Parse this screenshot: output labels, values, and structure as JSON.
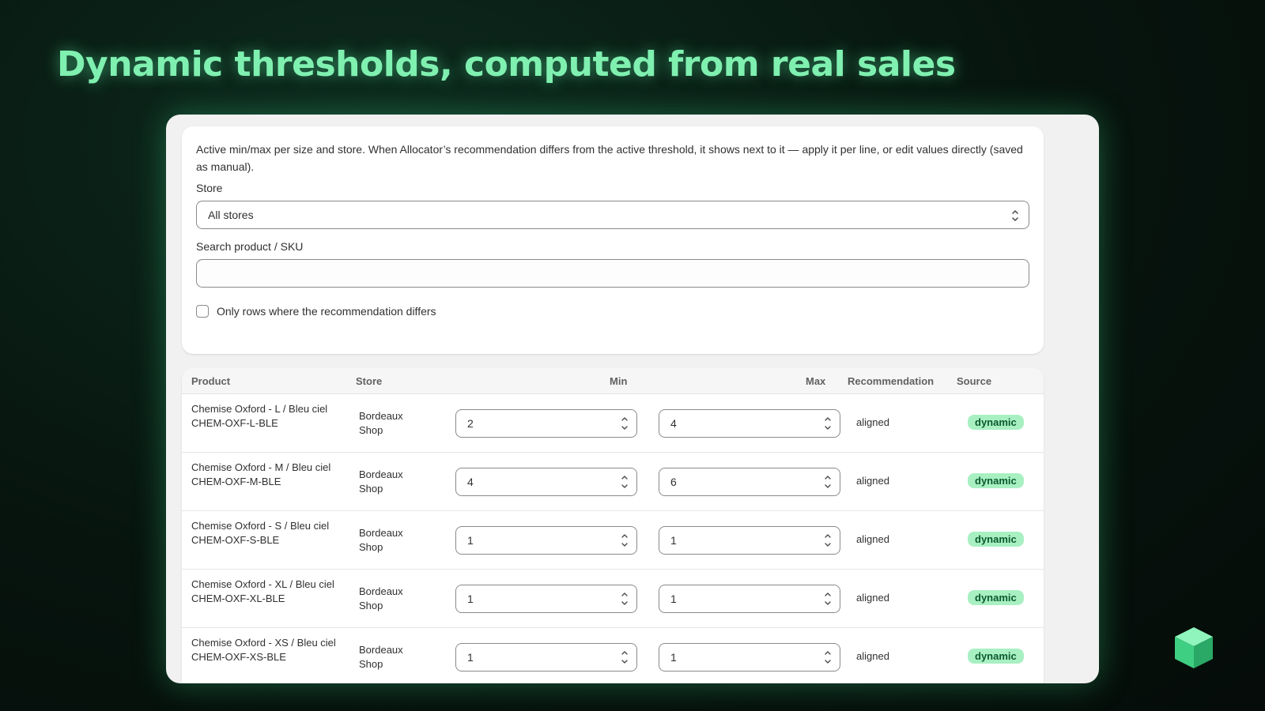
{
  "headline": "Dynamic thresholds, computed from real sales",
  "filters": {
    "description": "Active min/max per size and store. When Allocator’s recommendation differs from the active threshold, it shows next to it — apply it per line, or edit values directly (saved as manual).",
    "store_label": "Store",
    "store_value": "All stores",
    "search_label": "Search product / SKU",
    "search_value": "",
    "only_differs_label": "Only rows where the recommendation differs"
  },
  "table": {
    "headers": {
      "product": "Product",
      "store": "Store",
      "min": "Min",
      "max": "Max",
      "recommendation": "Recommendation",
      "source": "Source"
    },
    "rows": [
      {
        "product": "Chemise Oxford - L / Bleu ciel",
        "sku": "CHEM-OXF-L-BLE",
        "store": "Bordeaux Shop",
        "min": "2",
        "max": "4",
        "recommendation": "aligned",
        "source": "dynamic"
      },
      {
        "product": "Chemise Oxford - M / Bleu ciel",
        "sku": "CHEM-OXF-M-BLE",
        "store": "Bordeaux Shop",
        "min": "4",
        "max": "6",
        "recommendation": "aligned",
        "source": "dynamic"
      },
      {
        "product": "Chemise Oxford - S / Bleu ciel",
        "sku": "CHEM-OXF-S-BLE",
        "store": "Bordeaux Shop",
        "min": "1",
        "max": "1",
        "recommendation": "aligned",
        "source": "dynamic"
      },
      {
        "product": "Chemise Oxford - XL / Bleu ciel",
        "sku": "CHEM-OXF-XL-BLE",
        "store": "Bordeaux Shop",
        "min": "1",
        "max": "1",
        "recommendation": "aligned",
        "source": "dynamic"
      },
      {
        "product": "Chemise Oxford - XS / Bleu ciel",
        "sku": "CHEM-OXF-XS-BLE",
        "store": "Bordeaux Shop",
        "min": "1",
        "max": "1",
        "recommendation": "aligned",
        "source": "dynamic"
      }
    ]
  },
  "colors": {
    "accent": "#7ff0b0",
    "badge_bg": "#a8f0c2",
    "badge_text": "#0b5a2e"
  },
  "icons": {
    "select": "chevron-up-down-icon",
    "stepper": "stepper-arrows-icon",
    "brand": "green-cube-icon"
  }
}
